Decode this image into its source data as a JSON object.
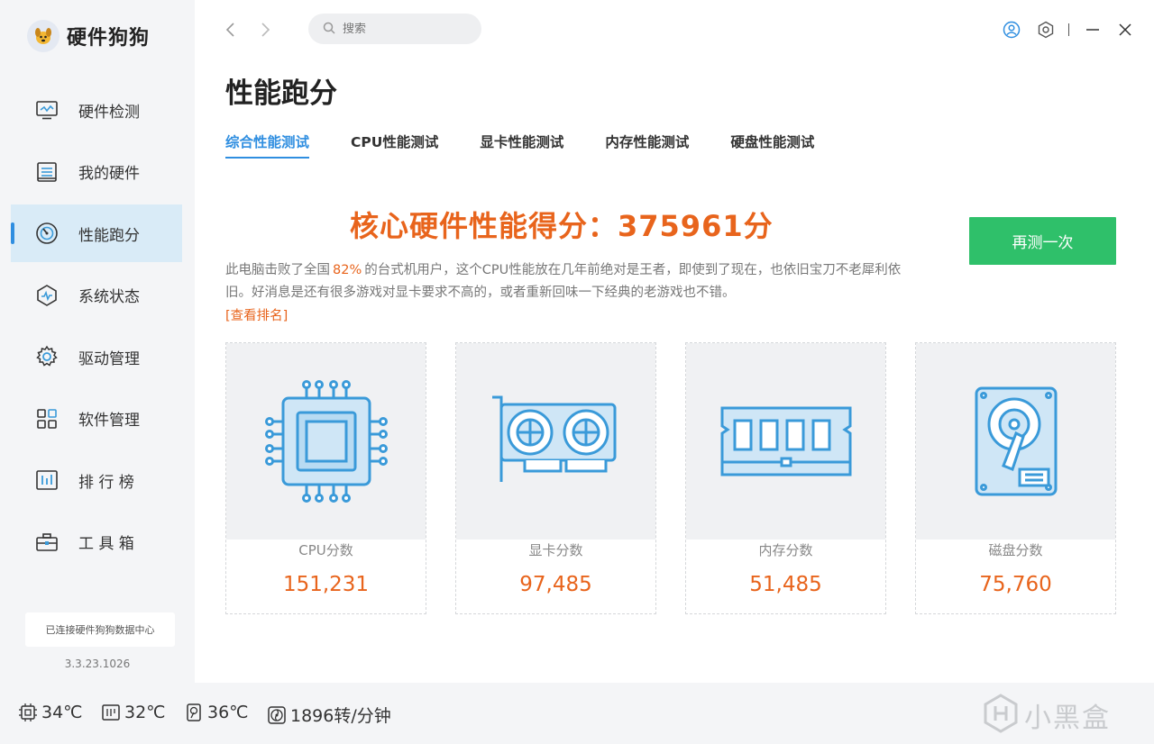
{
  "app": {
    "name": "硬件狗狗"
  },
  "sidebar": {
    "items": [
      {
        "label": "硬件检测",
        "icon": "monitor-icon"
      },
      {
        "label": "我的硬件",
        "icon": "hardware-icon"
      },
      {
        "label": "性能跑分",
        "icon": "speedometer-icon",
        "active": true
      },
      {
        "label": "系统状态",
        "icon": "system-status-icon"
      },
      {
        "label": "驱动管理",
        "icon": "gear-icon"
      },
      {
        "label": "软件管理",
        "icon": "apps-grid-icon"
      },
      {
        "label": "排 行 榜",
        "icon": "ranking-icon"
      },
      {
        "label": "工 具 箱",
        "icon": "toolbox-icon"
      }
    ],
    "connection": "已连接硬件狗狗数据中心",
    "version": "3.3.23.1026"
  },
  "topbar": {
    "search_placeholder": "搜索"
  },
  "page": {
    "title": "性能跑分",
    "tabs": [
      "综合性能测试",
      "CPU性能测试",
      "显卡性能测试",
      "内存性能测试",
      "硬盘性能测试"
    ],
    "active_tab": 0,
    "score_headline": "核心硬件性能得分：375961分",
    "retest_label": "再测一次",
    "desc_part1": "此电脑击败了全国",
    "desc_percent": "82%",
    "desc_part2": "的台式机用户，这个CPU性能放在几年前绝对是王者，即使到了现在，也依旧宝刀不老犀利依旧。好消息是还有很多游戏对显卡要求不高的，或者重新回味一下经典的老游戏也不错。",
    "rank_link": "[查看排名]"
  },
  "cards": [
    {
      "label": "CPU分数",
      "value": "151,231",
      "icon": "cpu-chip-icon"
    },
    {
      "label": "显卡分数",
      "value": "97,485",
      "icon": "graphics-card-icon"
    },
    {
      "label": "内存分数",
      "value": "51,485",
      "icon": "memory-stick-icon"
    },
    {
      "label": "磁盘分数",
      "value": "75,760",
      "icon": "hard-disk-icon"
    }
  ],
  "status": {
    "cpu_temp": "34℃",
    "board_temp": "32℃",
    "disk_temp": "36℃",
    "fan_speed": "1896转/分钟"
  },
  "watermark": "小黑盒",
  "colors": {
    "accent": "#2f8ee0",
    "score": "#e8641c",
    "button": "#2fc06a",
    "icon": "#3a9ad9"
  }
}
